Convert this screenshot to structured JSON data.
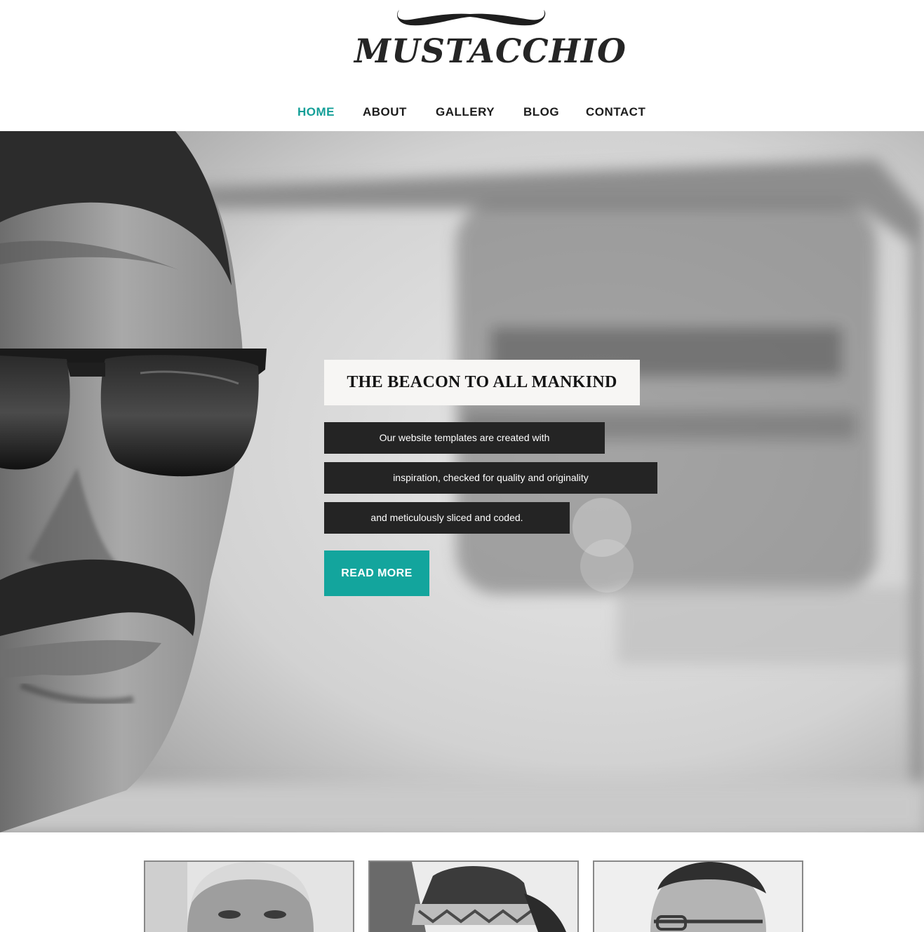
{
  "site": {
    "logo_text": "MUSTACCHIO"
  },
  "nav": {
    "items": [
      {
        "label": "HOME",
        "active": true
      },
      {
        "label": "ABOUT",
        "active": false
      },
      {
        "label": "GALLERY",
        "active": false
      },
      {
        "label": "BLOG",
        "active": false
      },
      {
        "label": "CONTACT",
        "active": false
      }
    ]
  },
  "hero": {
    "headline": "THE BEACON TO ALL MANKIND",
    "lines": [
      "Our website templates are created with",
      "inspiration, checked for quality and originality",
      "and meticulously sliced and coded."
    ],
    "button_label": "READ MORE"
  },
  "colors": {
    "accent": "#13a59d",
    "text_dark": "#1c1c1c",
    "caption_bg": "#242424"
  },
  "thumbnails": [
    {
      "icon": "portrait-grey-hair-icon"
    },
    {
      "icon": "portrait-fedora-hat-icon"
    },
    {
      "icon": "portrait-glasses-icon"
    }
  ]
}
